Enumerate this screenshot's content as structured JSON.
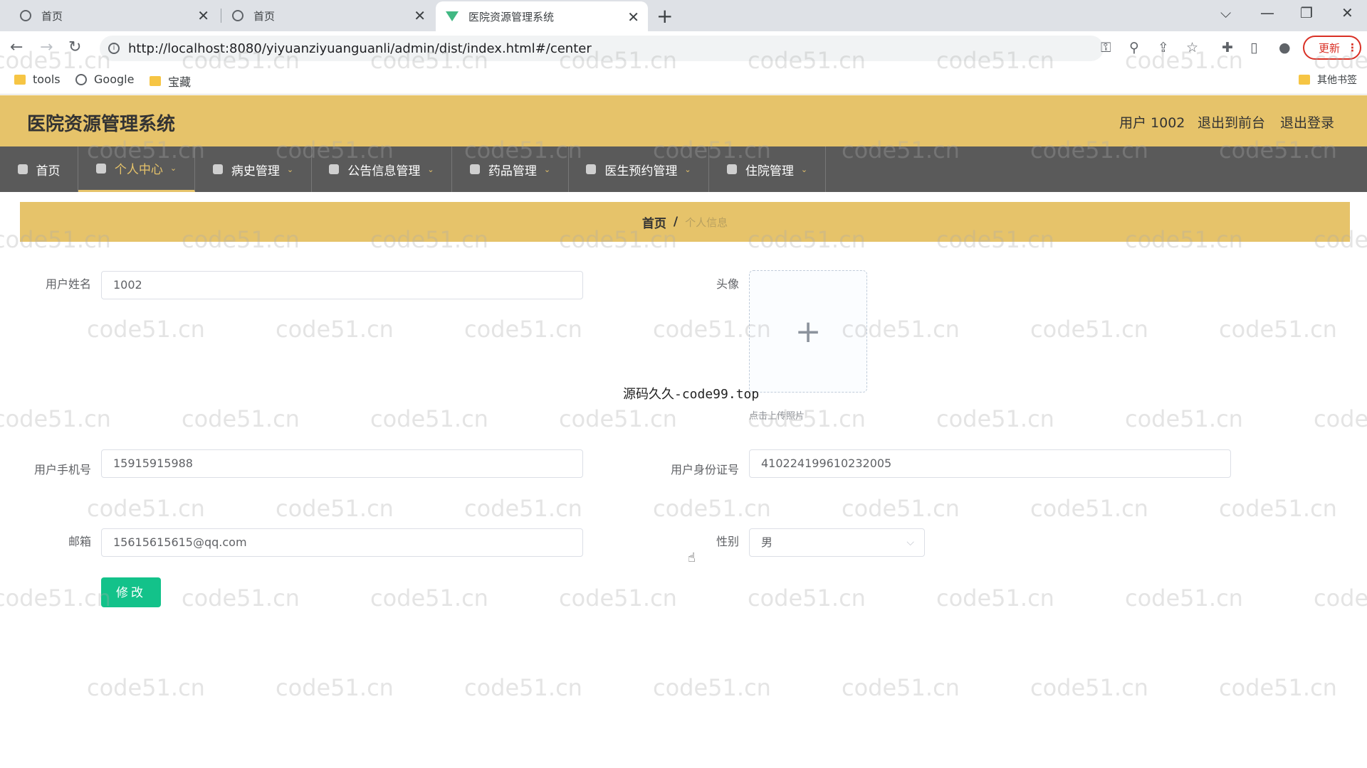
{
  "browser": {
    "tabs": [
      {
        "title": "首页",
        "close": "✕"
      },
      {
        "title": "首页",
        "close": "✕"
      },
      {
        "title": "医院资源管理系统",
        "close": "✕"
      }
    ],
    "new_tab": "+",
    "window_controls": {
      "dropdown": "⌵",
      "minimize": "—",
      "maximize": "❐",
      "close": "✕"
    },
    "nav": {
      "back": "←",
      "forward": "→",
      "reload": "↻"
    },
    "url": "http://localhost:8080/yiyuanziyuanguanli/admin/dist/index.html#/center",
    "toolbar_icons": {
      "key": "⚿",
      "zoom": "⚲",
      "share": "⇪",
      "star": "☆",
      "extensions": "✚",
      "sidebar": "▯",
      "profile": "●"
    },
    "update_label": "更新",
    "update_menu": "⋮",
    "bookmarks": [
      {
        "label": "tools",
        "icon": "folder-icon"
      },
      {
        "label": "Google",
        "icon": "globe-icon"
      },
      {
        "label": "宝藏",
        "icon": "folder-icon"
      }
    ],
    "other_bookmarks": "其他书签"
  },
  "app": {
    "title": "医院资源管理系统",
    "header_right": {
      "user": "用户 1002",
      "to_frontend": "退出到前台",
      "logout": "退出登录"
    },
    "menu": [
      {
        "label": "首页",
        "icon": "home-icon",
        "caret": ""
      },
      {
        "label": "个人中心",
        "icon": "user-icon",
        "caret": "⌄"
      },
      {
        "label": "病史管理",
        "icon": "history-icon",
        "caret": "⌄"
      },
      {
        "label": "公告信息管理",
        "icon": "notice-icon",
        "caret": "⌄"
      },
      {
        "label": "药品管理",
        "icon": "medicine-icon",
        "caret": "⌄"
      },
      {
        "label": "医生预约管理",
        "icon": "location-icon",
        "caret": "⌄"
      },
      {
        "label": "住院管理",
        "icon": "clipboard-icon",
        "caret": "⌄"
      }
    ],
    "accent_color": "#e6c36a",
    "menu_bg": "#5a5a5a"
  },
  "breadcrumb": {
    "home": "首页",
    "separator": "/",
    "current": "个人信息"
  },
  "form": {
    "username": {
      "label": "用户姓名",
      "value": "1002"
    },
    "avatar": {
      "label": "头像",
      "plus": "+",
      "tip": "点击上传照片"
    },
    "phone": {
      "label": "用户手机号",
      "value": "15915915988"
    },
    "id_number": {
      "label": "用户身份证号",
      "value": "410224199610232005"
    },
    "email": {
      "label": "邮箱",
      "value": "15615615615@qq.com"
    },
    "gender": {
      "label": "性别",
      "value": "男",
      "arrow": "⌵"
    },
    "submit": "修改"
  },
  "overlay_text": "源码久久-code99.top",
  "watermark": "code51.cn",
  "submit_color": "#13c28a"
}
